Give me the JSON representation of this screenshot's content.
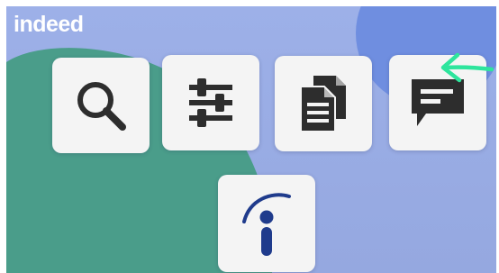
{
  "brand": {
    "name": "indeed"
  },
  "tiles": [
    {
      "icon": "search-icon"
    },
    {
      "icon": "sliders-icon"
    },
    {
      "icon": "documents-icon"
    },
    {
      "icon": "chat-icon"
    },
    {
      "icon": "indeed-logo-icon"
    }
  ],
  "colors": {
    "background_blue": "#9aaee6",
    "green_blob": "#4a9d8a",
    "deep_blue_circle": "#6f8ee0",
    "icon_dark": "#2d2d2d",
    "logo_navy": "#1f3b8c",
    "arrow_green": "#2ee59d",
    "tile_bg": "#f4f4f4"
  }
}
